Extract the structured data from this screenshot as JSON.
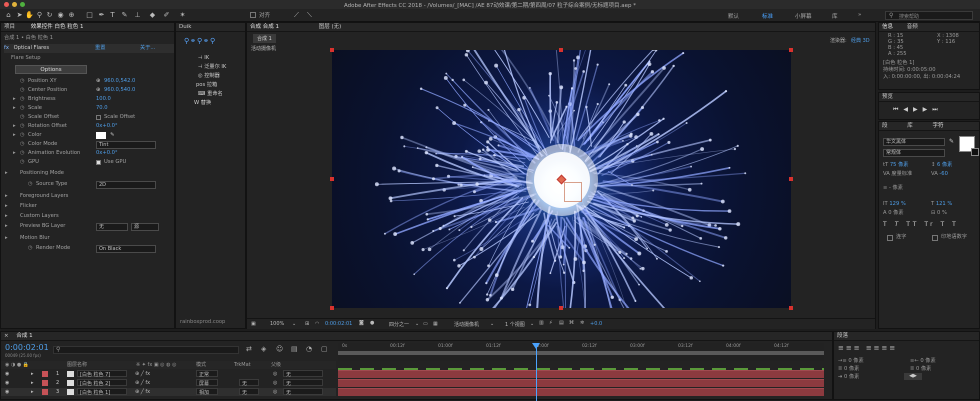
{
  "window": {
    "title": "Adobe After Effects CC 2018 - /Volumes/_[MAC] /AE 87动效课/第二期/第四周/07 粒子综合案例/无标题项目.aep *"
  },
  "toolbar": {
    "snap_label": "对齐"
  },
  "workspaces": {
    "items": [
      "默认",
      "标准",
      "小屏幕",
      "库"
    ],
    "active": "标准",
    "search_placeholder": "搜索帮助"
  },
  "left_panel": {
    "tabs": [
      "项目",
      "效果控件 白色 粒色 1"
    ],
    "layer_path": "合成 1 • 白色 粒色 1",
    "effect_name": "Optical Flares",
    "reset_label": "重置",
    "about_label": "关于...",
    "flare_setup": "Flare Setup",
    "options_label": "Options",
    "props": [
      {
        "label": "Position XY",
        "value": "960.0,542.0"
      },
      {
        "label": "Center Position",
        "value": "960.0,540.0"
      },
      {
        "label": "Brightness",
        "value": "100.0"
      },
      {
        "label": "Scale",
        "value": "70.0"
      },
      {
        "label": "Scale Offset",
        "value": "Scale Offset"
      },
      {
        "label": "Rotation Offset",
        "value": "0x+0.0°"
      },
      {
        "label": "Color",
        "value": ""
      },
      {
        "label": "Color Mode",
        "value": "Tint"
      },
      {
        "label": "Animation Evolution",
        "value": "0x+0.0°"
      },
      {
        "label": "GPU",
        "value": "Use GPU"
      },
      {
        "label": "Positioning Mode",
        "value": ""
      },
      {
        "label": "Source Type",
        "value": "2D"
      },
      {
        "label": "Foreground Layers",
        "value": ""
      },
      {
        "label": "Flicker",
        "value": ""
      },
      {
        "label": "Custom Layers",
        "value": ""
      },
      {
        "label": "Preview BG Layer",
        "value": "无"
      },
      {
        "label": "Motion Blur",
        "value": ""
      },
      {
        "label": "Render Mode",
        "value": "On Black"
      }
    ],
    "preview_bg_source": "源"
  },
  "duik_panel": {
    "title": "Duik",
    "items": [
      "IK",
      "泛量尔 IK",
      "控制器",
      "拉箱",
      "重命名",
      "替换"
    ],
    "footer": "rainboxprod.coop"
  },
  "viewer": {
    "tabs": [
      "合成 合成 1",
      "图层 (无)"
    ],
    "comp_tab": "合成 1",
    "camera_label": "活动摄像机",
    "renderer_label": "渲染器:",
    "renderer_value": "经典 3D",
    "zoom": "100%",
    "timecode": "0:00:02:01",
    "resolution": "四分之一",
    "camera_select": "活动摄像机",
    "views": "1 个视图",
    "exposure": "+0.0"
  },
  "info_panel": {
    "tabs": [
      "信息",
      "音频"
    ],
    "r": "R : 15",
    "g": "G : 35",
    "b": "B : 45",
    "a": "A : 255",
    "x": "X : 1308",
    "y": "Y : 116",
    "layer": "[白色 粒色 1]",
    "duration": "持续时间: 0:00:05:00",
    "inout": "入: 0:00:00:00,  出: 0:00:04:24"
  },
  "preview_panel": {
    "title": "预览"
  },
  "character_panel": {
    "tabs": [
      "段",
      "库",
      "字符"
    ],
    "font": "华文黑体",
    "style": "常规体",
    "size": "75 像素",
    "leading": "6 像素",
    "tracking": "度量标准",
    "kerning": "-60",
    "stroke": "- 像素",
    "v_scale": "129 %",
    "h_scale": "121 %",
    "baseline": "0 像素",
    "tsume": "0 %",
    "styles": [
      "T",
      "T",
      "TT",
      "Tr",
      "T",
      "T",
      "T",
      "T"
    ],
    "ligatures": "连字",
    "hindi": "印地语数字"
  },
  "paragraph_panel": {
    "title": "段落",
    "v1": "0 像素",
    "v2": "0 像素",
    "v3": "0 像素",
    "v4": "0 像素",
    "v5": "0 像素"
  },
  "timeline": {
    "tab": "合成 1",
    "timecode": "0:00:02:01",
    "fps": "00049 (25.00 fps)",
    "search_placeholder": "",
    "col_name": "图层名称",
    "col_mode": "模式",
    "col_trkmat": "TrkMat",
    "col_parent": "父级",
    "ruler": [
      "0s",
      "00:12f",
      "01:00f",
      "01:12f",
      "02:00f",
      "02:12f",
      "03:00f",
      "03:12f",
      "04:00f",
      "04:12f"
    ],
    "layers": [
      {
        "num": "1",
        "name": "[白色 粒色 7]",
        "mode": "正常",
        "trkmat": "",
        "parent": "无"
      },
      {
        "num": "2",
        "name": "[白色 粒色 2]",
        "mode": "屏幕",
        "trkmat": "无",
        "parent": "无"
      },
      {
        "num": "3",
        "name": "[白色 粒色 1]",
        "mode": "相加",
        "trkmat": "无",
        "parent": "无"
      }
    ]
  }
}
